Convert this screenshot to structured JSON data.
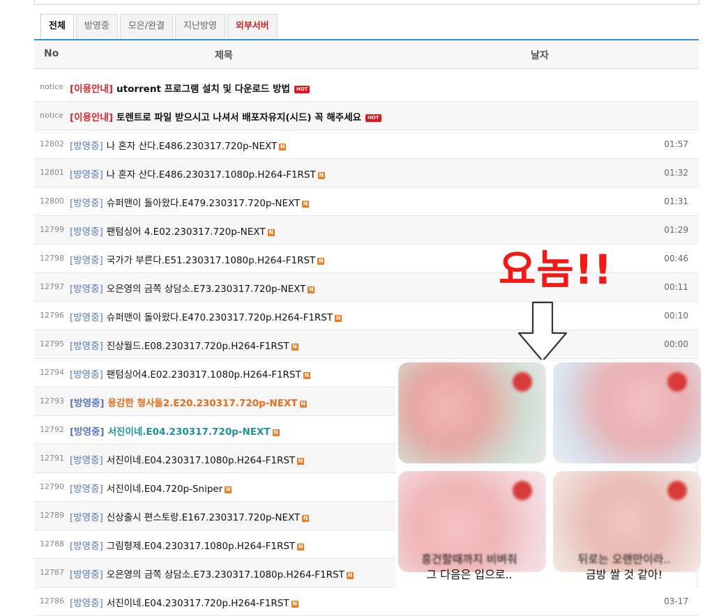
{
  "tabs": [
    {
      "label": "전체"
    },
    {
      "label": "방영중"
    },
    {
      "label": "모은/완결"
    },
    {
      "label": "지난방영"
    },
    {
      "label": "외부서버"
    }
  ],
  "table": {
    "headers": {
      "no": "No",
      "title": "제목",
      "date": "날자"
    },
    "rows": [
      {
        "no": "notice",
        "cat": "[이용안내]",
        "title": "utorrent 프로그램 설치 및 다운로드 방법",
        "badge": "HOT",
        "date": ""
      },
      {
        "no": "notice",
        "cat": "[이용안내]",
        "title": "토렌트로 파일 받으시고 나셔서 배포자유지(시드) 꼭 해주세요",
        "badge": "HOT",
        "date": ""
      },
      {
        "no": "12802",
        "cat": "[방영중]",
        "title": "나 혼자 산다.E486.230317.720p-NEXT",
        "badge": "N",
        "date": "01:57"
      },
      {
        "no": "12801",
        "cat": "[방영중]",
        "title": "나 혼자 산다.E486.230317.1080p.H264-F1RST",
        "badge": "N",
        "date": "01:32"
      },
      {
        "no": "12800",
        "cat": "[방영중]",
        "title": "슈퍼맨이 돌아왔다.E479.230317.720p-NEXT",
        "badge": "N",
        "date": "01:31"
      },
      {
        "no": "12799",
        "cat": "[방영중]",
        "title": "팬텀싱어 4.E02.230317.720p-NEXT",
        "badge": "N",
        "date": "01:29"
      },
      {
        "no": "12798",
        "cat": "[방영중]",
        "title": "국가가 부른다.E51.230317.1080p.H264-F1RST",
        "badge": "N",
        "date": "00:46"
      },
      {
        "no": "12797",
        "cat": "[방영중]",
        "title": "오은영의 금쪽 상담소.E73.230317.720p-NEXT",
        "badge": "N",
        "date": "00:11"
      },
      {
        "no": "12796",
        "cat": "[방영중]",
        "title": "슈퍼맨이 돌아왔다.E470.230317.720p.H264-F1RST",
        "badge": "N",
        "date": "00:10"
      },
      {
        "no": "12795",
        "cat": "[방영중]",
        "title": "진상월드.E08.230317.720p.H264-F1RST",
        "badge": "N",
        "date": "00:00"
      },
      {
        "no": "12794",
        "cat": "[방영중]",
        "title": "팬텀싱어4.E02.230317.1080p.H264-F1RST",
        "badge": "N",
        "date": ""
      },
      {
        "no": "12793",
        "cat": "[방영중]",
        "title": "용감한 형사들2.E20.230317.720p-NEXT",
        "badge": "N",
        "date": "",
        "style": "orange"
      },
      {
        "no": "12792",
        "cat": "[방영중]",
        "title": "서진이네.E04.230317.720p-NEXT",
        "badge": "N",
        "date": "",
        "style": "teal"
      },
      {
        "no": "12791",
        "cat": "[방영중]",
        "title": "서진이네.E04.230317.1080p.H264-F1RST",
        "badge": "N",
        "date": ""
      },
      {
        "no": "12790",
        "cat": "[방영중]",
        "title": "서진이네.E04.720p-Sniper",
        "badge": "N",
        "date": ""
      },
      {
        "no": "12789",
        "cat": "[방영중]",
        "title": "신상출시 편스토랑.E167.230317.720p-NEXT",
        "badge": "N",
        "date": ""
      },
      {
        "no": "12788",
        "cat": "[방영중]",
        "title": "그림형제.E04.230317.1080p.H264-F1RST",
        "badge": "N",
        "date": ""
      },
      {
        "no": "12787",
        "cat": "[방영중]",
        "title": "오은영의 금쪽 상담소.E73.230317.1080p.H264-F1RST",
        "badge": "N",
        "date": ""
      },
      {
        "no": "12786",
        "cat": "[방영중]",
        "title": "서진이네.E04.230317.720p.H264-F1RST",
        "badge": "N",
        "date": "03-17"
      }
    ]
  },
  "annotation": {
    "text": "요놈!!"
  },
  "ad": {
    "caption_left_line1": "흥건할때까지 비벼줘",
    "caption_left_line2": "그 다음은 입으로..",
    "caption_right_line1": "뒤로는 오랜만이라..",
    "caption_right_line2": "금방 쌀 것 같아!"
  },
  "colors": {
    "accent": "#3b8bd8",
    "notice_red": "#e0262a",
    "category_blue": "#5b78c7",
    "annotation_red": "#f21a17"
  }
}
